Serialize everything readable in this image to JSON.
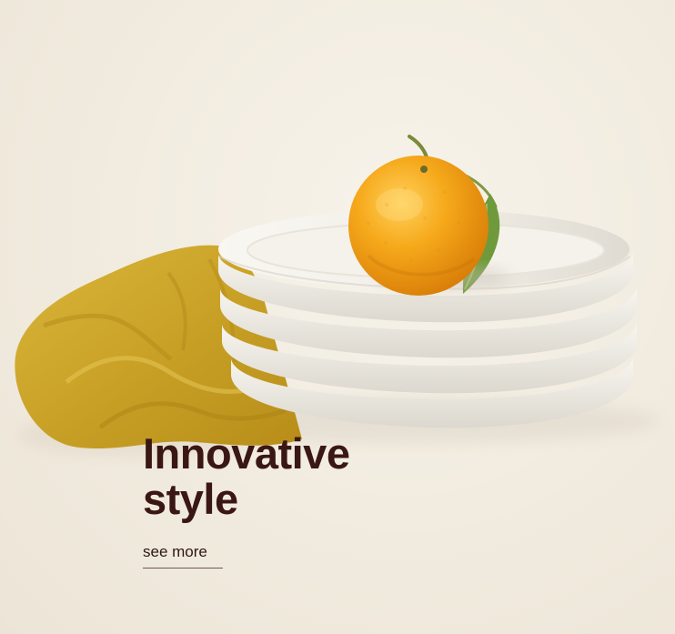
{
  "hero": {
    "title_line_1": "Innovative",
    "title_line_2": "style",
    "cta_label": "see more"
  },
  "colors": {
    "background": "#f3efe6",
    "plate": "#f0ede5",
    "cloth": "#d4ad2a",
    "orange": "#f2a31a",
    "leaf": "#6f9a3b",
    "title_text": "#3a1712"
  },
  "icons": {
    "photo_subject": "plates-orange-cloth-illustration"
  }
}
